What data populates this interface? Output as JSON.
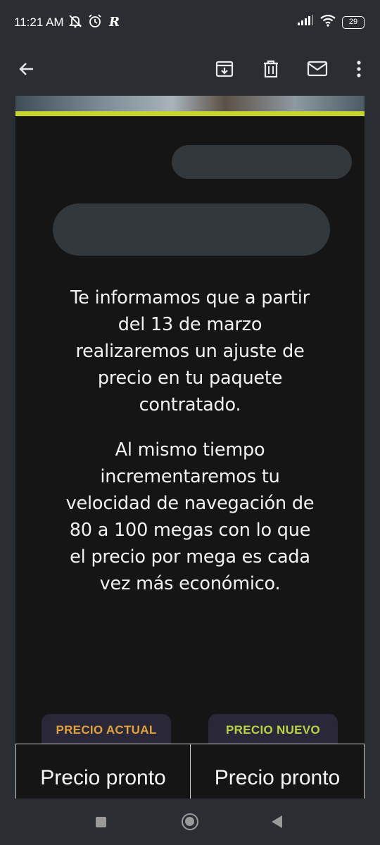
{
  "status_bar": {
    "time": "11:21 AM",
    "battery": "29",
    "icons": [
      "mute-notifications-icon",
      "alarm-icon",
      "r-app-icon",
      "signal-icon",
      "wifi-icon",
      "battery-icon"
    ]
  },
  "toolbar": {
    "icons": [
      "back-arrow-icon",
      "archive-icon",
      "delete-icon",
      "mark-unread-icon",
      "more-options-icon"
    ]
  },
  "email": {
    "paragraph_1": "Te informamos que a partir del 13 de marzo realizaremos un ajuste de precio en tu paquete contratado.",
    "paragraph_2": "Al mismo tiempo incrementaremos tu velocidad de navegación de 80 a 100 megas con lo que el precio por mega es cada vez más económico.",
    "badge_current": "PRECIO ACTUAL",
    "badge_new": "PRECIO NUEVO",
    "price_current": "Precio pronto",
    "price_new": "Precio pronto"
  },
  "colors": {
    "accent_line": "#c6d62e",
    "badge_current_text": "#e2a23b",
    "badge_new_text": "#b8d446",
    "email_background": "#151515",
    "chrome_background": "#2a2d31"
  }
}
